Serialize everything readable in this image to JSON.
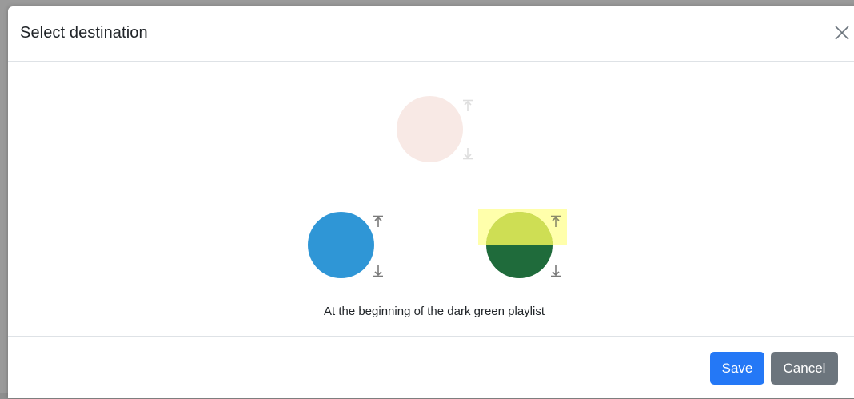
{
  "dialog": {
    "title": "Select destination",
    "close_icon": "close-icon"
  },
  "playlists": [
    {
      "name": "faded",
      "color": "#f8e9e5",
      "state": "disabled"
    },
    {
      "name": "blue",
      "color": "#2f96d6",
      "state": "normal"
    },
    {
      "name": "dark green",
      "color": "#1f6b3b",
      "top_color": "#93b53e",
      "state": "selected"
    }
  ],
  "icons": {
    "move_top": "arrow-to-top-icon",
    "move_bottom": "arrow-to-bottom-icon"
  },
  "colors": {
    "highlight": "#ffff66",
    "arrow": "#7a7a7a",
    "arrow_faded": "#dedede",
    "save": "#2478f6",
    "cancel": "#6c757d"
  },
  "caption": "At the beginning of the dark green playlist",
  "footer": {
    "save_label": "Save",
    "cancel_label": "Cancel"
  }
}
